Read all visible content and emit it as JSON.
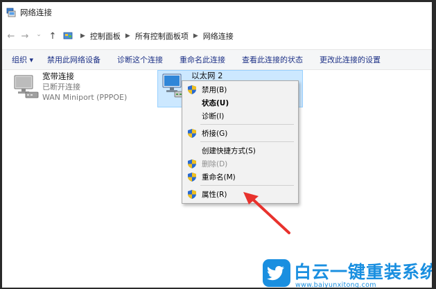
{
  "window": {
    "title": "网络连接",
    "title_icon": "network-connections-icon"
  },
  "address_bar": {
    "breadcrumbs": [
      "控制面板",
      "所有控制面板项",
      "网络连接"
    ],
    "back_icon": "arrow-left-icon",
    "forward_icon": "arrow-right-icon",
    "recent_icon": "chevron-down-icon",
    "up_icon": "arrow-up-icon"
  },
  "command_bar": {
    "organize": "组织 ▾",
    "disable": "禁用此网络设备",
    "diagnose": "诊断这个连接",
    "rename": "重命名此连接",
    "view_status": "查看此连接的状态",
    "change_settings": "更改此连接的设置"
  },
  "connections": [
    {
      "name": "宽带连接",
      "status": "已断开连接",
      "device": "WAN Miniport (PPPOE)",
      "icon": "broadband-connection-icon"
    },
    {
      "name": "以太网 2",
      "status": "",
      "device": "",
      "icon": "ethernet-connection-icon",
      "selected": true
    }
  ],
  "context_menu": {
    "disable": "禁用(B)",
    "status": "状态(U)",
    "diagnose": "诊断(I)",
    "bridge": "桥接(G)",
    "create_shortcut": "创建快捷方式(S)",
    "delete": "删除(D)",
    "rename": "重命名(M)",
    "properties": "属性(R)"
  },
  "annotation": {
    "arrow_color": "#e8322d",
    "points_to": "属性(R)"
  },
  "watermark": {
    "brand": "白云一键重装系统",
    "url": "www.baiyunxitong.com",
    "color": "#1a8fe0"
  }
}
